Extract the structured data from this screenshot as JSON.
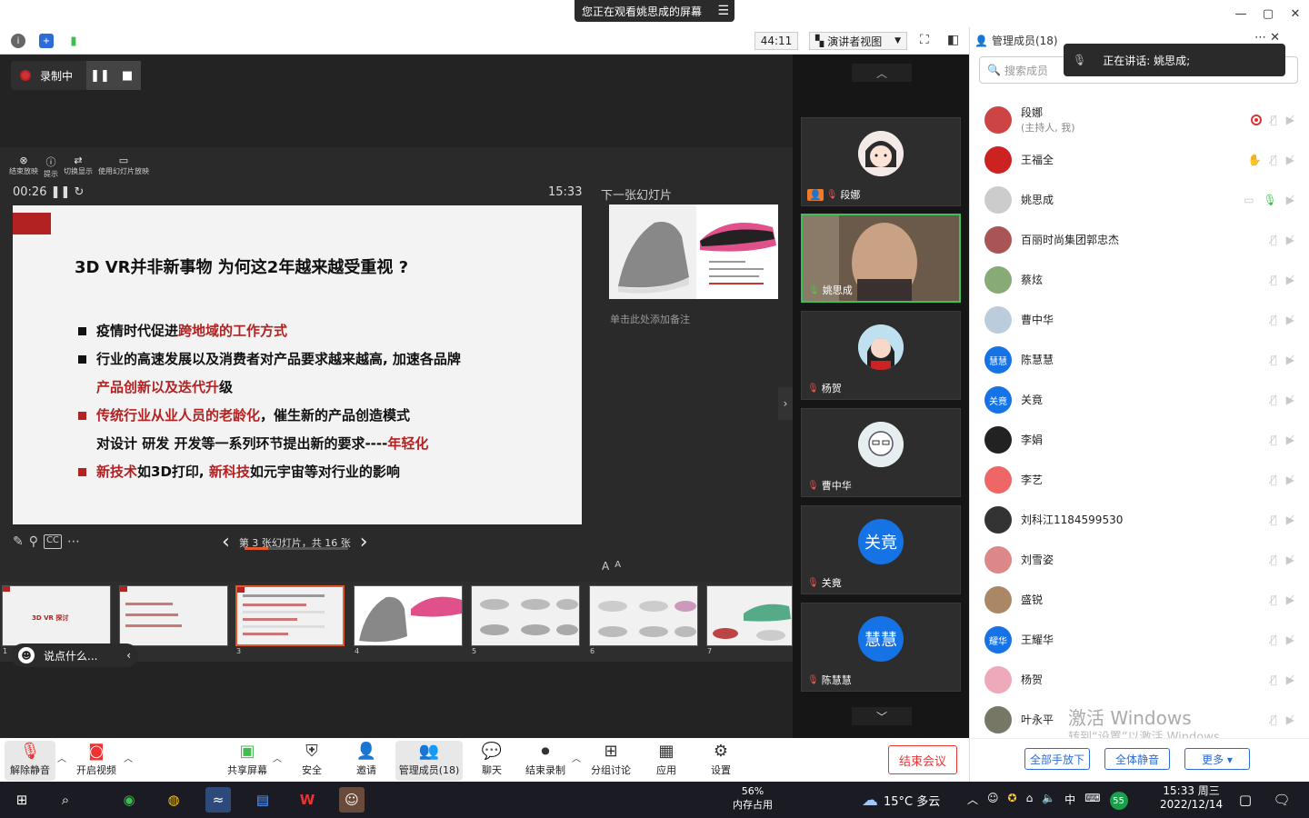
{
  "banner": {
    "text": "您正在观看姚思成的屏幕"
  },
  "window": {
    "minimize": "—",
    "maximize": "▢",
    "close": "✕"
  },
  "toolbar": {
    "timer": "44:11",
    "presenter_view": "演讲者视图"
  },
  "recording": {
    "label": "录制中"
  },
  "ppt": {
    "tools": [
      {
        "label": "结束放映"
      },
      {
        "label": "提示"
      },
      {
        "label": "切换显示"
      },
      {
        "label": "使用幻灯片放映"
      }
    ],
    "elapsed": "00:26",
    "clock": "15:33",
    "next_label": "下一张幻灯片",
    "notes_hint": "单击此处添加备注",
    "nav": "第 3 张幻灯片，共 16 张",
    "slide": {
      "title": "3D VR并非新事物 为何这2年越来越受重视 ?",
      "b1a": "疫情时代促进",
      "b1b": "跨地域的工作方式",
      "b2a": "行业的高速发展以及消费者对产品要求越来越高, 加速各品牌",
      "b2b": "产品创新以及迭代升",
      "b2c": "级",
      "b3a": "传统行业从业人员的老龄化",
      "b3b": "，催生新的产品创造模式",
      "b3c": "对设计 研发  开发等一系列环节提出新的要求----",
      "b3d": "年轻化",
      "b4a": "新技术",
      "b4b": "如3D打印, ",
      "b4c": "新科技",
      "b4d": "如元宇宙等对行业的影响"
    },
    "thumbs": [
      {
        "num": "1",
        "title": "3D VR 探讨"
      },
      {
        "num": "2"
      },
      {
        "num": "3"
      },
      {
        "num": "4"
      },
      {
        "num": "5"
      },
      {
        "num": "6"
      },
      {
        "num": "7"
      }
    ],
    "font_up": "A",
    "font_down": "A"
  },
  "chat": {
    "placeholder": "说点什么..."
  },
  "videos": [
    {
      "name": "段娜"
    },
    {
      "name": "姚思成"
    },
    {
      "name": "杨贺"
    },
    {
      "name": "曹中华"
    },
    {
      "name": "关竟",
      "initials": "关竟"
    },
    {
      "name": "陈慧慧",
      "initials": "慧慧"
    }
  ],
  "members": {
    "title": "管理成员(18)",
    "search_placeholder": "搜索成员",
    "speaking": "正在讲话: 姚思成;",
    "list": [
      {
        "name": "段娜",
        "sub": "(主持人, 我)"
      },
      {
        "name": "王福全"
      },
      {
        "name": "姚思成"
      },
      {
        "name": "百丽时尚集团郭忠杰"
      },
      {
        "name": "蔡炫"
      },
      {
        "name": "曹中华"
      },
      {
        "name": "陈慧慧",
        "initials": "慧慧"
      },
      {
        "name": "关竟",
        "initials": "关竟"
      },
      {
        "name": "李娟"
      },
      {
        "name": "李艺"
      },
      {
        "name": "刘科江1184599530"
      },
      {
        "name": "刘雪姿"
      },
      {
        "name": "盛锐"
      },
      {
        "name": "王耀华",
        "initials": "耀华"
      },
      {
        "name": "杨贺"
      },
      {
        "name": "叶永平"
      }
    ],
    "watermark1": "激活 Windows",
    "watermark2": "转到“设置”以激活 Windows。",
    "btn_lower_all": "全部手放下",
    "btn_mute_all": "全体静音",
    "btn_more": "更多 ▾"
  },
  "bottombar": {
    "unmute": "解除静音",
    "video": "开启视频",
    "share": "共享屏幕",
    "security": "安全",
    "invite": "邀请",
    "manage": "管理成员(18)",
    "chat": "聊天",
    "end_rec": "结束录制",
    "breakout": "分组讨论",
    "apps": "应用",
    "settings": "设置",
    "end_meeting": "结束会议"
  },
  "taskbar": {
    "mem_pct": "56%",
    "mem_label": "内存占用",
    "weather": "15°C  多云",
    "time": "15:33 周三",
    "date": "2022/12/14",
    "input": "中",
    "badge": "55"
  }
}
